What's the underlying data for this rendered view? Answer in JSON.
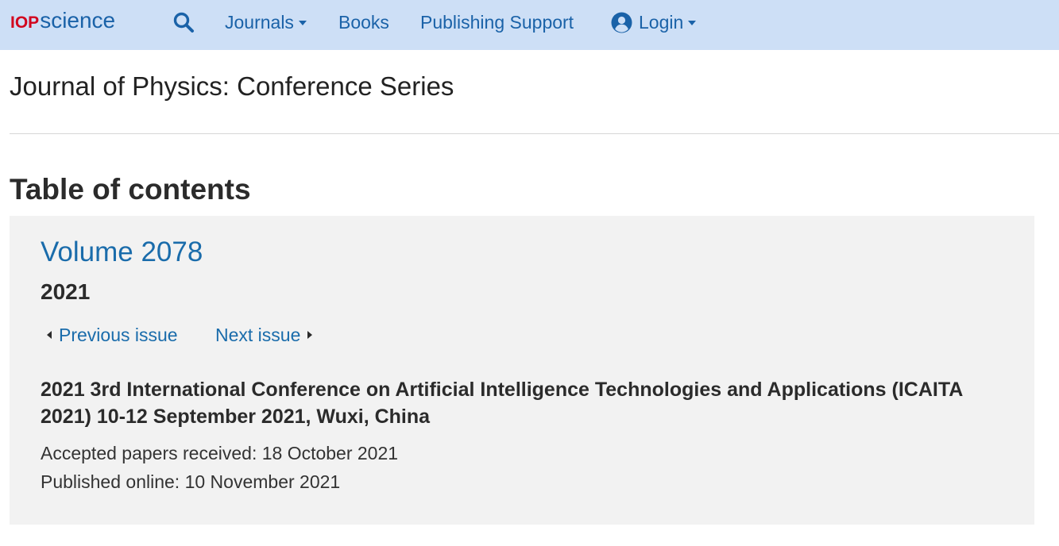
{
  "brand": {
    "logo_iop": "IOP",
    "logo_science": "science"
  },
  "nav": {
    "search_icon": "search-icon",
    "journals_label": "Journals",
    "books_label": "Books",
    "publishing_support_label": "Publishing Support",
    "login_label": "Login"
  },
  "journal": {
    "title": "Journal of Physics: Conference Series"
  },
  "toc": {
    "heading": "Table of contents",
    "volume": "Volume 2078",
    "year": "2021",
    "previous_issue": "Previous issue",
    "next_issue": "Next issue",
    "conference_title": "2021 3rd International Conference on Artificial Intelligence Technologies and Applications (ICAITA 2021) 10-12 September 2021, Wuxi, China",
    "accepted": "Accepted papers received: 18 October 2021",
    "published": "Published online: 10 November 2021"
  },
  "colors": {
    "topbar_bg": "#cddff6",
    "link_blue": "#1a62a8",
    "logo_red": "#d2051e",
    "panel_bg": "#f2f2f2"
  }
}
